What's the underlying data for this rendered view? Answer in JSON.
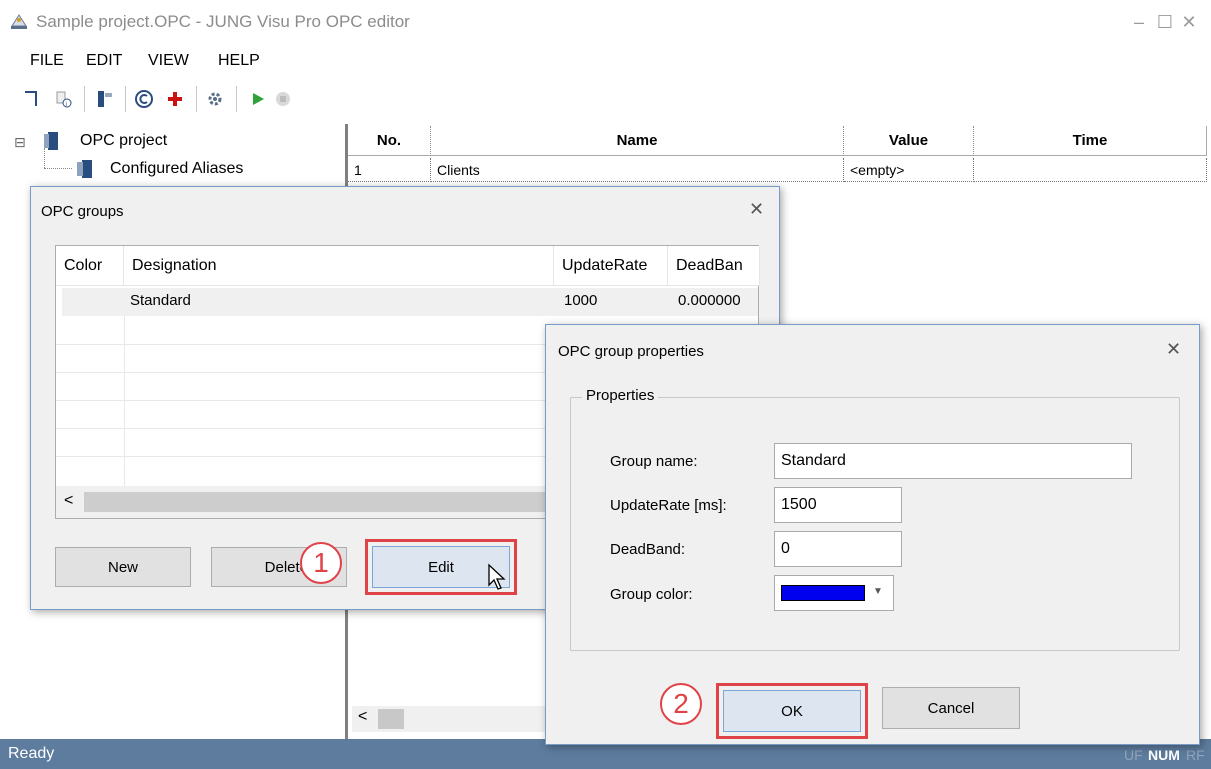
{
  "window": {
    "title": "Sample project.OPC - JUNG Visu Pro OPC editor",
    "minimize": "–",
    "maximize": "☐",
    "close": "✕"
  },
  "menu": [
    "FILE",
    "EDIT",
    "VIEW",
    "HELP"
  ],
  "tree": {
    "expander": "⊟",
    "root": "OPC project",
    "child": "Configured Aliases"
  },
  "grid": {
    "columns": [
      "No.",
      "Name",
      "Value",
      "Time"
    ],
    "rows": [
      {
        "no": "1",
        "name": "Clients",
        "value": "<empty>",
        "time": ""
      }
    ],
    "scroll_left": "<"
  },
  "status": {
    "text": "Ready",
    "indicators": [
      "UF",
      "NUM",
      "RF"
    ]
  },
  "opc_groups_dialog": {
    "title": "OPC groups",
    "close": "✕",
    "columns": [
      "Color",
      "Designation",
      "UpdateRate",
      "DeadBan"
    ],
    "rows": [
      {
        "color": "",
        "designation": "Standard",
        "updaterate": "1000",
        "deadband": "0.000000"
      }
    ],
    "scroll_left": "<",
    "buttons": {
      "new": "New",
      "delete": "Delete",
      "edit": "Edit"
    },
    "callout": "1"
  },
  "group_properties_dialog": {
    "title": "OPC group properties",
    "close": "✕",
    "groupbox": "Properties",
    "fields": {
      "group_name_label": "Group name:",
      "group_name_value": "Standard",
      "update_rate_label": "UpdateRate [ms]:",
      "update_rate_value": "1500",
      "deadband_label": "DeadBand:",
      "deadband_value": "0",
      "group_color_label": "Group color:",
      "group_color_value": "#0000ee"
    },
    "buttons": {
      "ok": "OK",
      "cancel": "Cancel"
    },
    "callout": "2"
  },
  "colors": {
    "accent_red": "#e04347",
    "statusbar": "#5d7c9e",
    "selection_blue": "#0000ee"
  }
}
